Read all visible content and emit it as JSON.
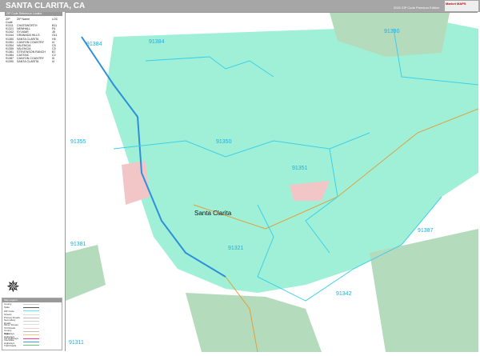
{
  "header": {
    "title": "SANTA CLARITA, CA",
    "edition": "2020 ZIP Code Premium Edition",
    "logo": "Market MAPS"
  },
  "zip_index": {
    "title": "ZIP Code Reference Locator",
    "columns": [
      "ZIP Code",
      "ZIP Name",
      "LOC"
    ],
    "rows": [
      [
        "91311",
        "CHATSWORTH",
        "B11"
      ],
      [
        "91321",
        "NEWHALL",
        "F6"
      ],
      [
        "91342",
        "SYLMAR",
        "J8"
      ],
      [
        "91344",
        "GRANADA HILLS",
        "G11"
      ],
      [
        "91350",
        "SANTA CLARITA",
        "H5"
      ],
      [
        "91351",
        "CANYON COUNTRY",
        "I4"
      ],
      [
        "91354",
        "VALENCIA",
        "C5"
      ],
      [
        "91355",
        "VALENCIA",
        "C5"
      ],
      [
        "91381",
        "STEVENSON RANCH",
        "B7"
      ],
      [
        "91384",
        "CASTAIC",
        "C2"
      ],
      [
        "91387",
        "CANYON COUNTRY",
        "I5"
      ],
      [
        "91390",
        "SANTA CLARITA",
        "I4"
      ]
    ]
  },
  "map": {
    "city": "Santa Clarita",
    "zip_labels": [
      {
        "code": "91384"
      },
      {
        "code": "91384"
      },
      {
        "code": "91390"
      },
      {
        "code": "91355"
      },
      {
        "code": "91350"
      },
      {
        "code": "91351"
      },
      {
        "code": "91381"
      },
      {
        "code": "91321"
      },
      {
        "code": "91387"
      },
      {
        "code": "91342"
      },
      {
        "code": "91311"
      }
    ]
  },
  "legend": {
    "title": "Map Legend",
    "items": [
      "County",
      "State",
      "ZIP Code",
      "Streets",
      "Primary Roads",
      "Secondary Roads",
      "Minor Streets",
      "Toll Roads",
      "County Highways",
      "State Highways",
      "US Highways",
      "Interstate Highways",
      "Trail Roads"
    ],
    "colors": {
      "land": "#9ff0d6",
      "park": "#b5dbbd",
      "urban": "#f2c6c6",
      "zip_line": "#3dd0ea",
      "highway": "#2f8fd8"
    }
  }
}
